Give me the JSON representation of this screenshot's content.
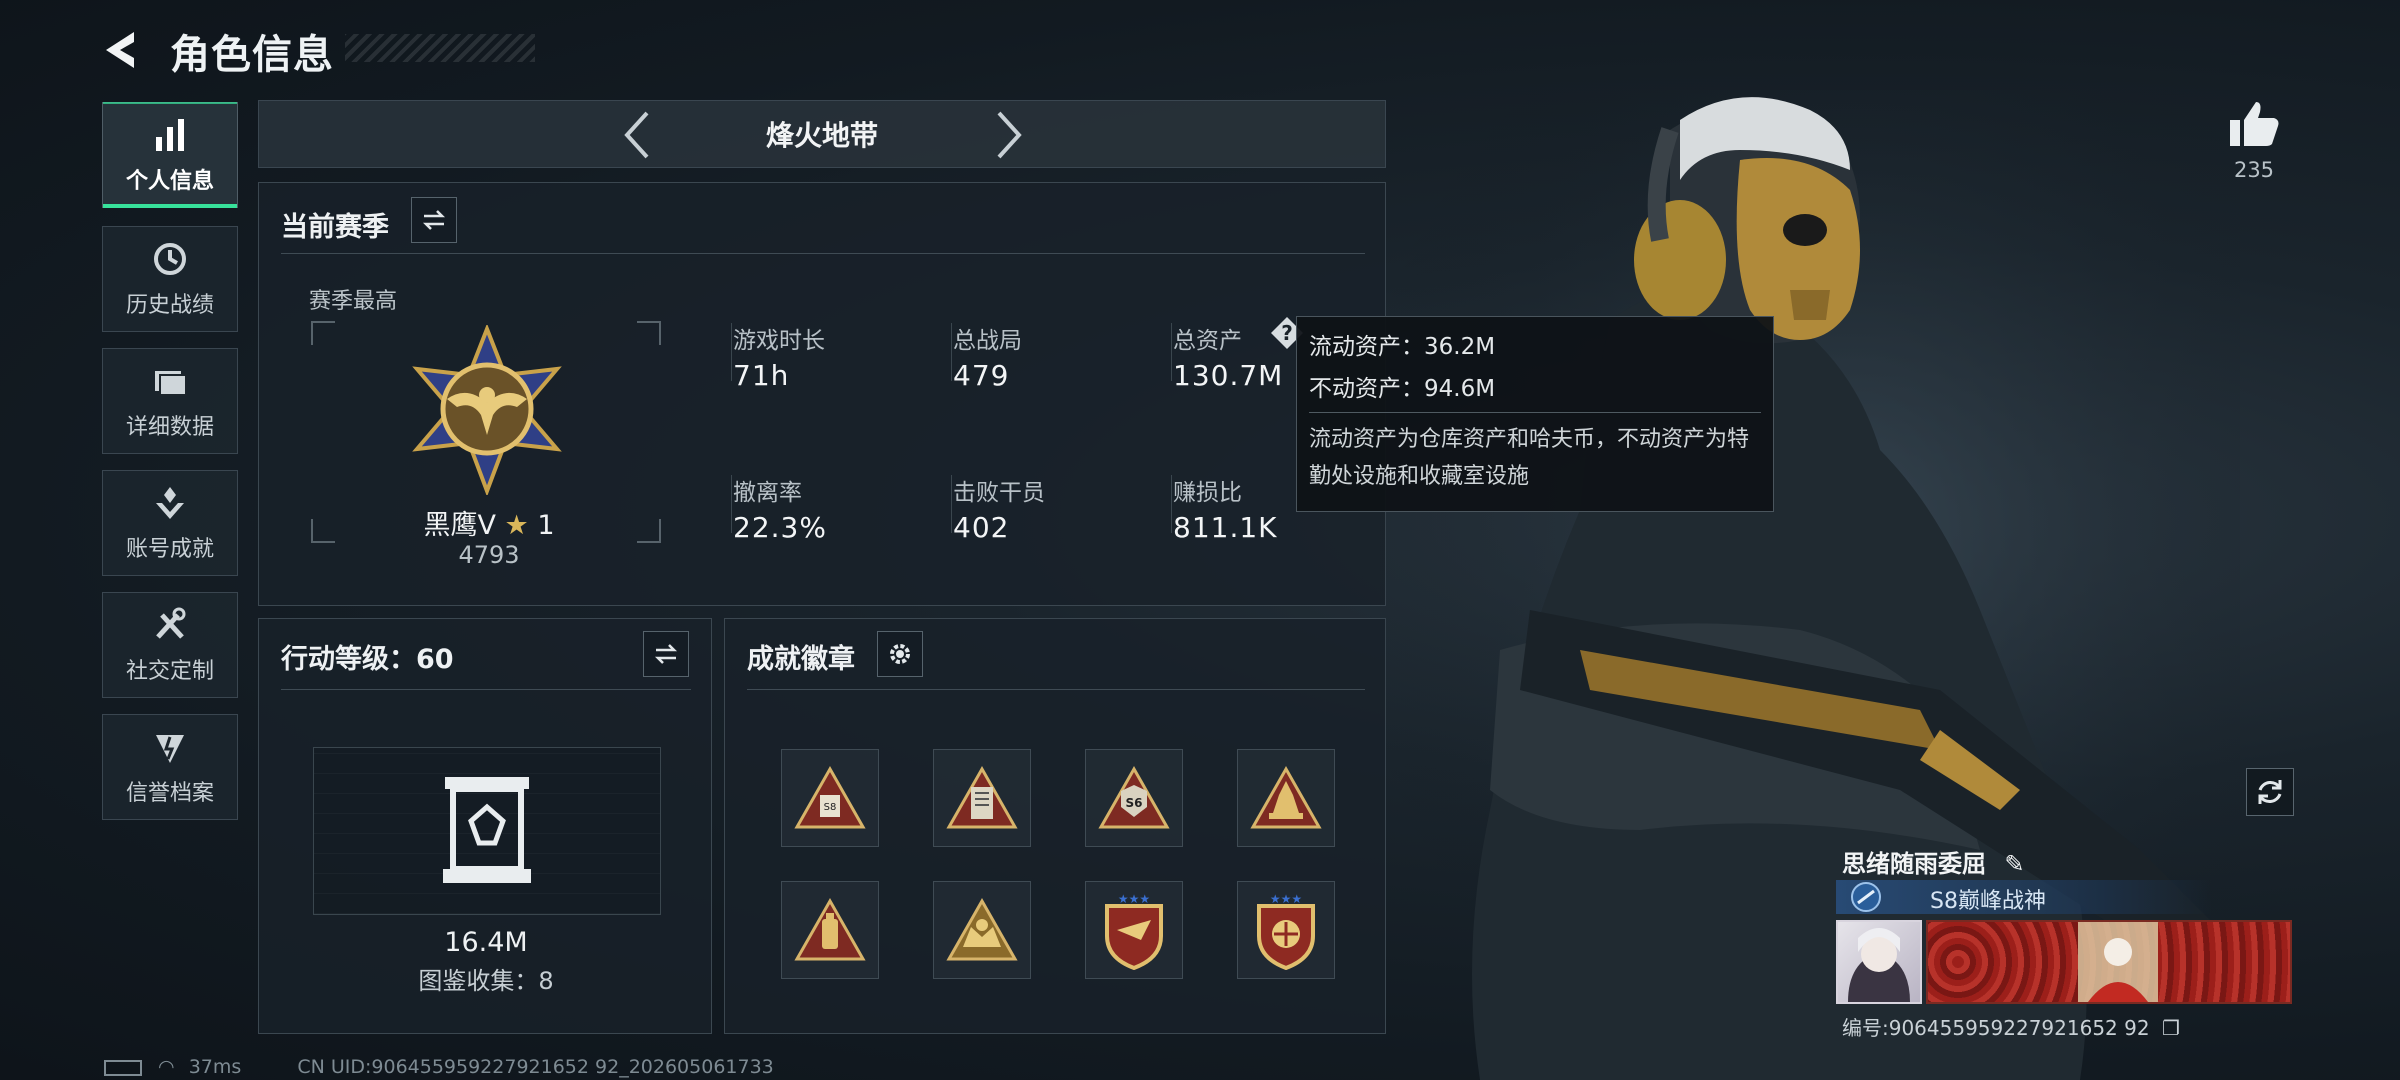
{
  "header": {
    "title": "角色信息"
  },
  "sidebar": {
    "items": [
      {
        "label": "个人信息",
        "icon": "bar-chart-icon",
        "active": true
      },
      {
        "label": "历史战绩",
        "icon": "history-icon"
      },
      {
        "label": "详细数据",
        "icon": "folder-icon"
      },
      {
        "label": "账号成就",
        "icon": "achievement-icon"
      },
      {
        "label": "社交定制",
        "icon": "tools-icon"
      },
      {
        "label": "信誉档案",
        "icon": "credit-icon"
      }
    ]
  },
  "mode": {
    "title": "烽火地带"
  },
  "season": {
    "title": "当前赛季",
    "best_label": "赛季最高",
    "rank_name": "黑鹰Ⅴ",
    "rank_star": "1",
    "rank_score": "4793",
    "stats": [
      {
        "label": "游戏时长",
        "value": "71h"
      },
      {
        "label": "总战局",
        "value": "479"
      },
      {
        "label": "总资产",
        "value": "130.7M"
      },
      {
        "label": "撤离率",
        "value": "22.3%"
      },
      {
        "label": "击败干员",
        "value": "402"
      },
      {
        "label": "赚损比",
        "value": "811.1K"
      }
    ]
  },
  "tooltip": {
    "liquid": "流动资产：36.2M",
    "fixed": "不动资产：94.6M",
    "desc": "流动资产为仓库资产和哈夫币，不动资产为特勤处设施和收藏室设施"
  },
  "action_level": {
    "title": "行动等级：60",
    "value": "16.4M",
    "collection": "图鉴收集：8"
  },
  "achievements": {
    "title": "成就徽章"
  },
  "likes": {
    "count": "235"
  },
  "player": {
    "name": "思绪随雨委屈",
    "title": "S8巅峰战神",
    "uid_card": "编号:906455959227921652 92"
  },
  "status": {
    "ping": "37ms",
    "uid": "CN UID:906455959227921652 92_202605061733"
  },
  "colors": {
    "accent": "#37e29b",
    "gold": "#c9a24a",
    "badge_red": "#8e2a22"
  }
}
